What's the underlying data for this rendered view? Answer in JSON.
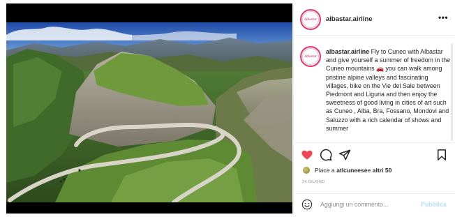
{
  "post": {
    "username": "albastar.airline",
    "avatar_text": "Albastar",
    "more_icon": "•••",
    "caption_user": "albastar.airline",
    "caption_text": " Fly to Cuneo with Albastar and give yourself a summer of freedom in the Cuneo mountains 🚗 you can walk among pristine alpine valleys and fascinating villages, bike on the Vie del Sale between Piedmont and Liguria and then enjoy the sweetness of good living in cities of art such as Cuneo , Alba, Bra, Fossano, Mondovi and Saluzzo with a rich calendar of shows and summer",
    "likes_prefix": "Piace a ",
    "likes_user": "atlcuneese",
    "likes_middle": " e ",
    "likes_others": "altri 50",
    "date": "24 GIUGNO",
    "comment_placeholder": "Aggiungi un commento...",
    "publish_label": "Pubblica"
  },
  "icons": {
    "like": "heart-icon",
    "comment": "comment-bubble-icon",
    "share": "paper-plane-icon",
    "save": "bookmark-icon",
    "emoji": "smiley-icon",
    "more": "more-dots-icon"
  },
  "colors": {
    "like_active": "#ed4956",
    "publish_disabled": "#b2dffc",
    "avatar_ring": "#e6326a",
    "secondary_text": "#8e8e8e"
  }
}
